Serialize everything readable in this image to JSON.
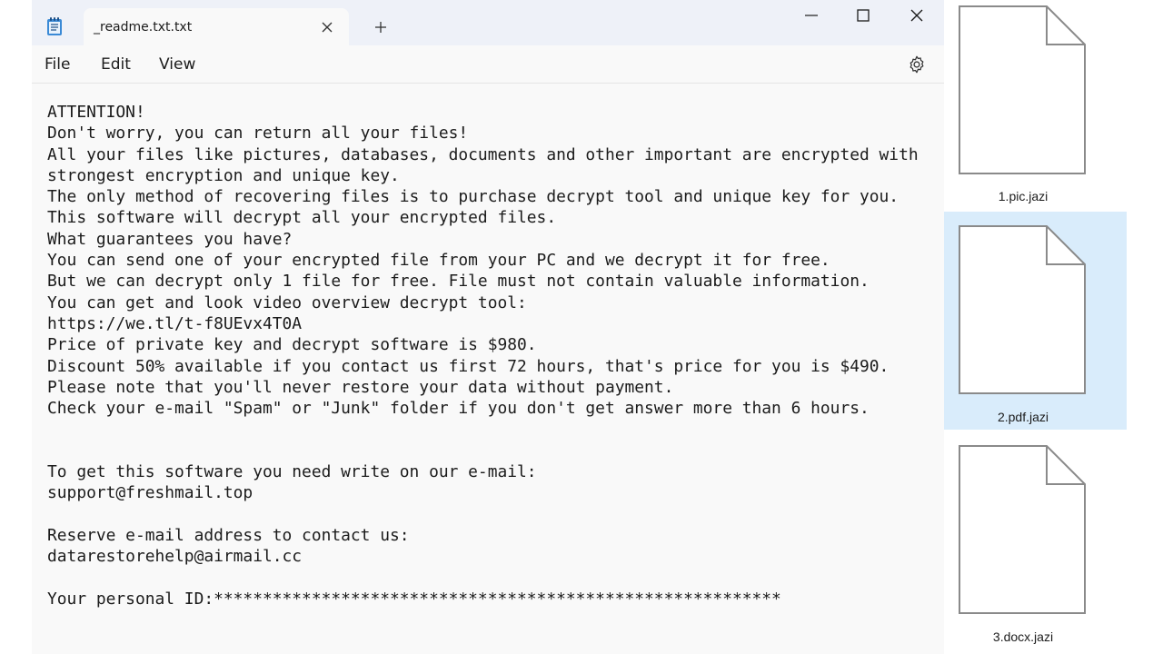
{
  "window": {
    "tab_title": "_readme.txt.txt",
    "new_tab_symbol": "+",
    "app_icon": "notepad-icon"
  },
  "menu": {
    "file": "File",
    "edit": "Edit",
    "view": "View",
    "settings_icon": "gear-icon"
  },
  "editor": {
    "lines": [
      "ATTENTION!",
      "Don't worry, you can return all your files!",
      "All your files like pictures, databases, documents and other important are encrypted with",
      "strongest encryption and unique key.",
      "The only method of recovering files is to purchase decrypt tool and unique key for you.",
      "This software will decrypt all your encrypted files.",
      "What guarantees you have?",
      "You can send one of your encrypted file from your PC and we decrypt it for free.",
      "But we can decrypt only 1 file for free. File must not contain valuable information.",
      "You can get and look video overview decrypt tool:",
      "https://we.tl/t-f8UEvx4T0A",
      "Price of private key and decrypt software is $980.",
      "Discount 50% available if you contact us first 72 hours, that's price for you is $490.",
      "Please note that you'll never restore your data without payment.",
      "Check your e-mail \"Spam\" or \"Junk\" folder if you don't get answer more than 6 hours.",
      "",
      "",
      "To get this software you need write on our e-mail:",
      "support@freshmail.top",
      "",
      "Reserve e-mail address to contact us:",
      "datarestorehelp@airmail.cc",
      "",
      "Your personal ID:**********************************************************"
    ]
  },
  "explorer": {
    "files": [
      {
        "name": "1.pic.jazi",
        "selected": false
      },
      {
        "name": "2.pdf.jazi",
        "selected": true
      },
      {
        "name": "3.docx.jazi",
        "selected": false
      }
    ]
  },
  "colors": {
    "titlebar_bg": "#eef1f8",
    "editor_bg": "#f9f9f9",
    "selection_bg": "#d9ecfb"
  }
}
